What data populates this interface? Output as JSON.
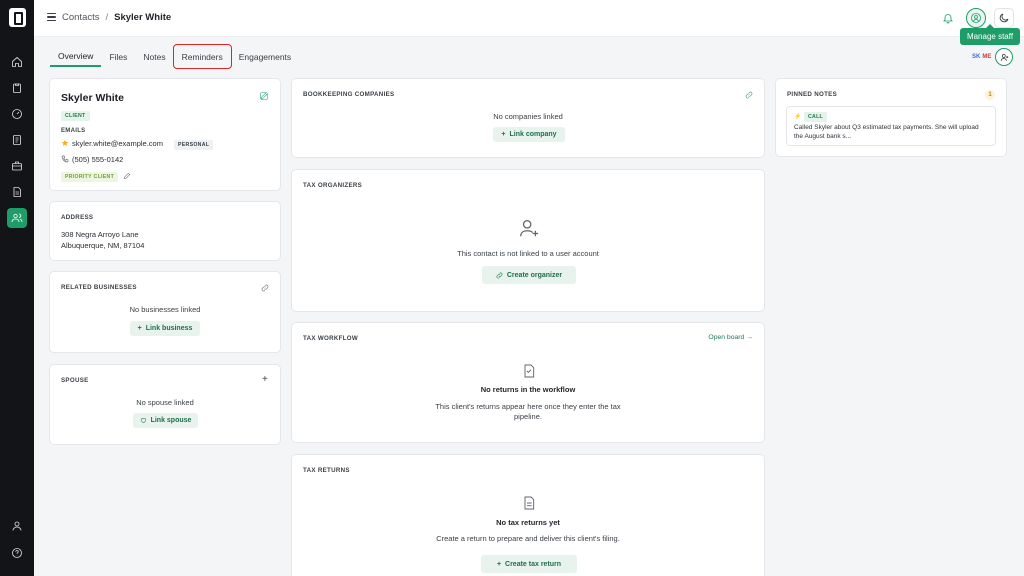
{
  "breadcrumb": {
    "root": "Contacts",
    "separator": "/",
    "current": "Skyler White"
  },
  "tooltip": "Manage staff",
  "tabs": [
    "Overview",
    "Files",
    "Notes",
    "Reminders",
    "Engagements"
  ],
  "avatars": {
    "initials_1": "SK",
    "initials_2": "ME"
  },
  "colors": {
    "accent": "#1f9d68",
    "highlight": "#e02424",
    "sidebar": "#121417"
  },
  "sidebar_icons": [
    "home-icon",
    "clipboard-icon",
    "gauge-icon",
    "document-icon",
    "briefcase-icon",
    "file-text-icon",
    "users-icon",
    "user-icon",
    "help-icon"
  ],
  "contact": {
    "name": "Skyler White",
    "badge": "CLIENT",
    "emails_label": "EMAILS",
    "email": "skyler.white@example.com",
    "email_tag": "PERSONAL",
    "phone": "(505) 555-0142",
    "priority": "PRIORITY CLIENT"
  },
  "address": {
    "title": "ADDRESS",
    "line1": "308 Negra Arroyo Lane",
    "line2": "Albuquerque, NM, 87104"
  },
  "related": {
    "title": "RELATED BUSINESSES",
    "empty": "No businesses linked",
    "button": "Link business"
  },
  "spouse": {
    "title": "SPOUSE",
    "empty": "No spouse linked",
    "button": "Link spouse"
  },
  "bookkeeping": {
    "title": "BOOKKEEPING COMPANIES",
    "empty": "No companies linked",
    "button": "Link company"
  },
  "organizers": {
    "title": "TAX ORGANIZERS",
    "empty": "This contact is not linked to a user account",
    "button": "Create organizer"
  },
  "workflow": {
    "title": "TAX WORKFLOW",
    "link": "Open board →",
    "heading": "No returns in the workflow",
    "desc_1": "This client's returns appear here once they enter the tax",
    "desc_2": "pipeline."
  },
  "returns": {
    "title": "TAX RETURNS",
    "heading": "No tax returns yet",
    "desc": "Create a return to prepare and deliver this client's filing.",
    "button": "Create tax return"
  },
  "pinned": {
    "title": "PINNED NOTES",
    "count": "1",
    "tag": "CALL",
    "text": "Called Skyler about Q3 estimated tax payments. She will upload the August bank s..."
  }
}
